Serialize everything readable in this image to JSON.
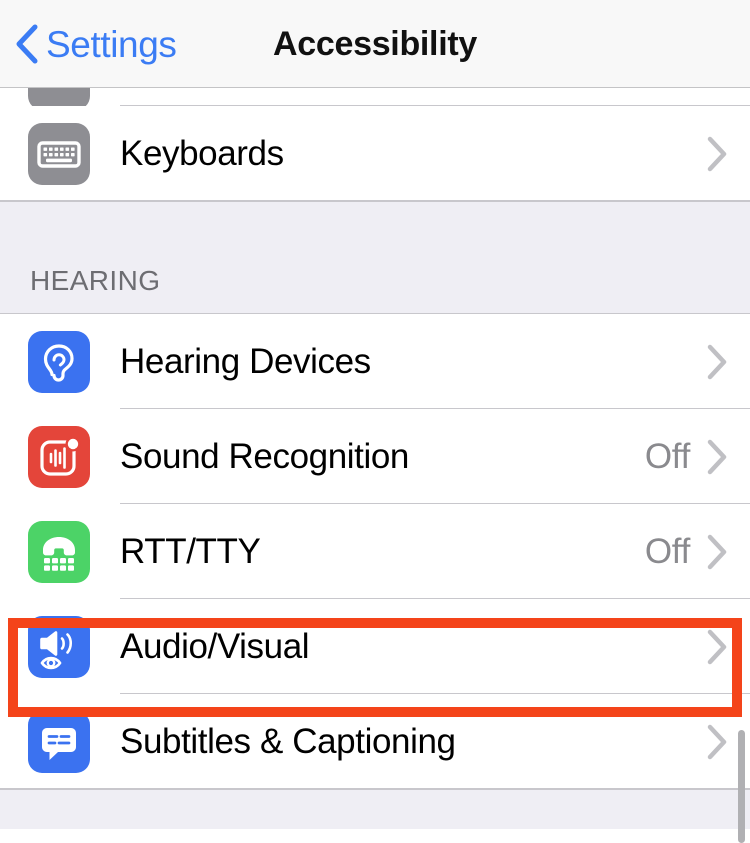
{
  "navbar": {
    "back_label": "Settings",
    "back_icon": "chevron-left-icon",
    "title": "Accessibility"
  },
  "sections": [
    {
      "id": "keyboards-group",
      "header": "",
      "rows": [
        {
          "id": "keyboards",
          "label": "Keyboards",
          "value": "",
          "icon": "keyboard-icon",
          "icon_color": "#8e8e93",
          "accessory": "chevron-right-icon"
        }
      ]
    },
    {
      "id": "hearing-group",
      "header": "HEARING",
      "rows": [
        {
          "id": "hearing-devices",
          "label": "Hearing Devices",
          "value": "",
          "icon": "ear-icon",
          "icon_color": "#3b72f0",
          "accessory": "chevron-right-icon"
        },
        {
          "id": "sound-recognition",
          "label": "Sound Recognition",
          "value": "Off",
          "icon": "sound-waveform-icon",
          "icon_color": "#e4453a",
          "accessory": "chevron-right-icon"
        },
        {
          "id": "rtt-tty",
          "label": "RTT/TTY",
          "value": "Off",
          "icon": "tty-phone-icon",
          "icon_color": "#4cd367",
          "accessory": "chevron-right-icon"
        },
        {
          "id": "audio-visual",
          "label": "Audio/Visual",
          "value": "",
          "icon": "speaker-eye-icon",
          "icon_color": "#3b72f0",
          "accessory": "chevron-right-icon",
          "highlighted": true
        },
        {
          "id": "subtitles-captioning",
          "label": "Subtitles & Captioning",
          "value": "",
          "icon": "caption-bubble-icon",
          "icon_color": "#3b72f0",
          "accessory": "chevron-right-icon"
        }
      ]
    }
  ],
  "annotation": {
    "target": "audio-visual",
    "color": "#f4441a"
  },
  "colors": {
    "accent_blue": "#3b7cf4",
    "group_background": "#efeef4",
    "separator": "#c8c7cc",
    "value_text": "#8a8a8e",
    "header_background": "#f8f8f8"
  },
  "scrollbar": {
    "name": "vertical-scrollbar"
  }
}
